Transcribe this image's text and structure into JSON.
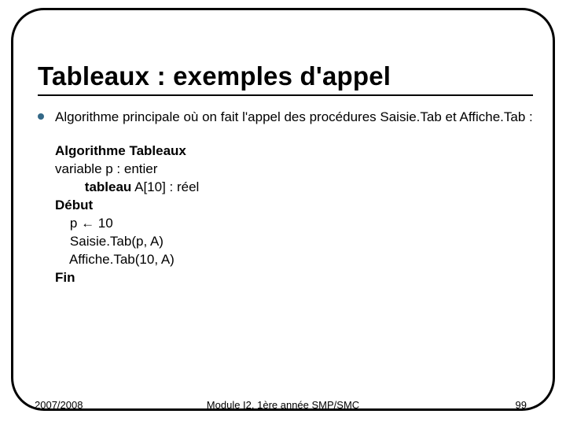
{
  "title": "Tableaux : exemples d'appel",
  "intro": "Algorithme principale où on fait l'appel des procédures Saisie.Tab et Affiche.Tab :",
  "algo": {
    "header_kw": "Algorithme",
    "header_name": " Tableaux",
    "var_decl": "variable p : entier",
    "tab_kw": "tableau",
    "tab_rest": " A[10] : réel",
    "begin": "Début",
    "stmt1": "p ← 10",
    "stmt2": "Saisie.Tab(p, A)",
    "stmt3": "Affiche.Tab(10, A)",
    "end": "Fin"
  },
  "footer": {
    "left": "2007/2008",
    "center": "Module I2, 1ère année SMP/SMC",
    "right": "99"
  }
}
